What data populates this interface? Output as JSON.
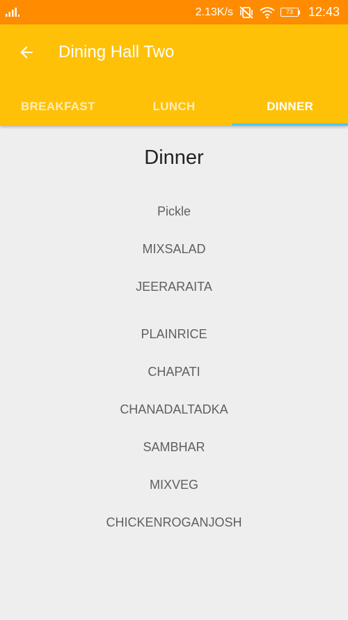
{
  "status_bar": {
    "signal_icon": "signal-bars-icon",
    "net_speed": "2.13K/s",
    "mute_icon": "vibrate-mute-icon",
    "wifi_icon": "wifi-icon",
    "battery_level": "73",
    "time": "12:43",
    "color": "#ff8c00"
  },
  "app_bar": {
    "back_icon": "arrow-back-icon",
    "title": "Dining Hall Two",
    "color": "#ffc107"
  },
  "tabs": [
    {
      "label": "BREAKFAST",
      "active": false
    },
    {
      "label": "LUNCH",
      "active": false
    },
    {
      "label": "DINNER",
      "active": true
    }
  ],
  "tab_indicator_color": "#4fc3f7",
  "menu": {
    "title": "Dinner",
    "items": [
      "Pickle",
      "MIXSALAD",
      "JEERARAITA",
      "PLAINRICE",
      "CHAPATI",
      "CHANADALTADKA",
      "SAMBHAR",
      "MIXVEG",
      "CHICKENROGANJOSH"
    ]
  }
}
